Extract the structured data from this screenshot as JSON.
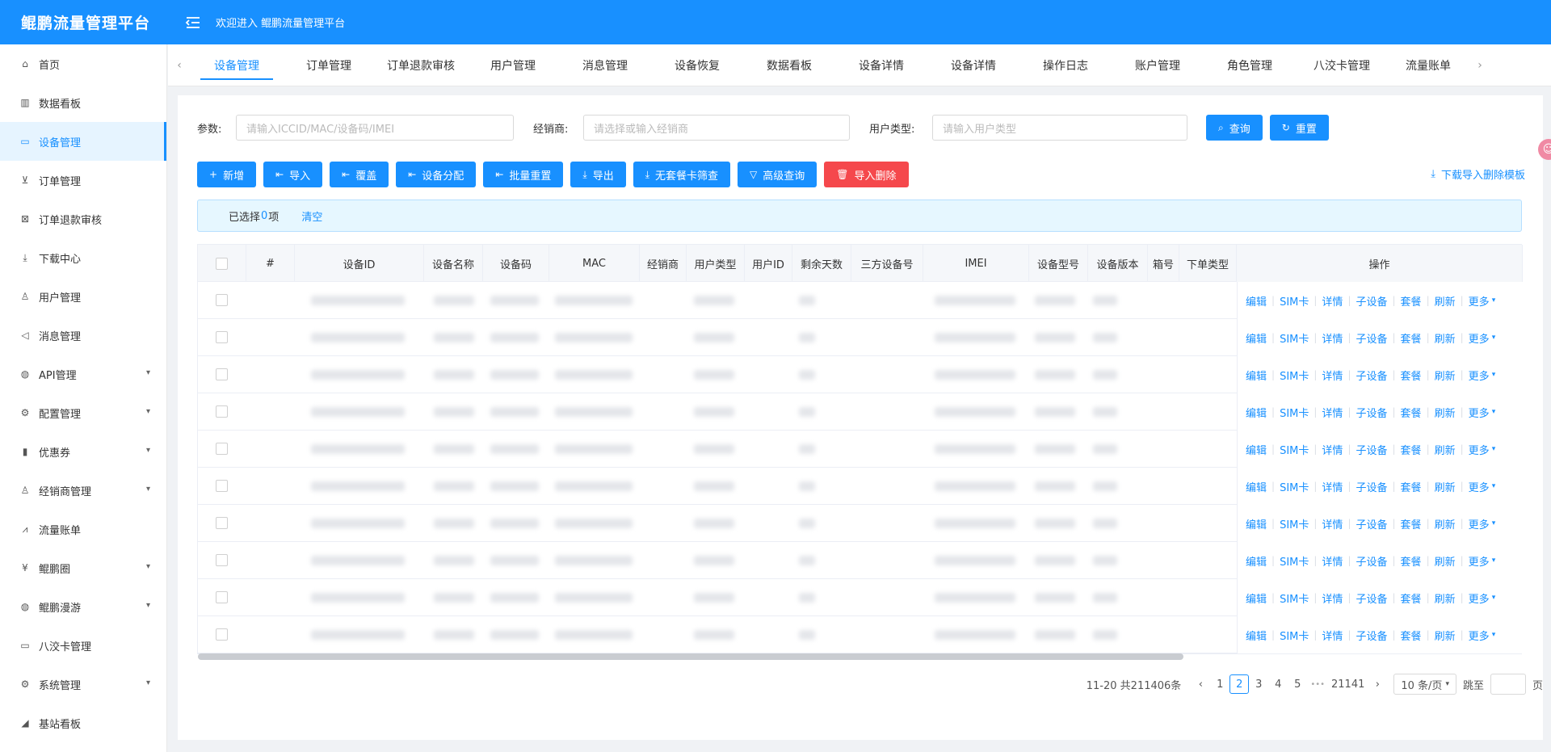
{
  "app": {
    "title": "鲲鹏流量管理平台",
    "welcome": "欢迎进入 鲲鹏流量管理平台"
  },
  "sidebar": {
    "items": [
      {
        "label": "首页",
        "icon": "home-icon"
      },
      {
        "label": "数据看板",
        "icon": "bar-chart-icon"
      },
      {
        "label": "设备管理",
        "icon": "device-icon"
      },
      {
        "label": "订单管理",
        "icon": "cart-icon"
      },
      {
        "label": "订单退款审核",
        "icon": "refund-icon"
      },
      {
        "label": "下载中心",
        "icon": "download-icon"
      },
      {
        "label": "用户管理",
        "icon": "user-icon"
      },
      {
        "label": "消息管理",
        "icon": "speaker-icon"
      },
      {
        "label": "API管理",
        "icon": "globe-icon"
      },
      {
        "label": "配置管理",
        "icon": "gear-icon"
      },
      {
        "label": "优惠券",
        "icon": "barcode-icon"
      },
      {
        "label": "经销商管理",
        "icon": "user-icon"
      },
      {
        "label": "流量账单",
        "icon": "line-chart-icon"
      },
      {
        "label": "鲲鹏圈",
        "icon": "yen-icon"
      },
      {
        "label": "鲲鹏漫游",
        "icon": "globe-icon"
      },
      {
        "label": "八洨卡管理",
        "icon": "monitor-icon"
      },
      {
        "label": "系统管理",
        "icon": "gear-icon"
      },
      {
        "label": "基站看板",
        "icon": "area-chart-icon"
      }
    ]
  },
  "tabs": [
    "设备管理",
    "订单管理",
    "订单退款审核",
    "用户管理",
    "消息管理",
    "设备恢复",
    "数据看板",
    "设备详情",
    "设备详情",
    "操作日志",
    "账户管理",
    "角色管理",
    "八洨卡管理",
    "流量账单"
  ],
  "search": {
    "param_label": "参数:",
    "param_placeholder": "请输入ICCID/MAC/设备码/IMEI",
    "dealer_label": "经销商:",
    "dealer_placeholder": "请选择或输入经销商",
    "usertype_label": "用户类型:",
    "usertype_placeholder": "请输入用户类型",
    "query": "查询",
    "reset": "重置"
  },
  "actions": {
    "add": "新增",
    "import": "导入",
    "cover": "覆盖",
    "assign": "设备分配",
    "batch_reset": "批量重置",
    "export": "导出",
    "no_plan": "无套餐卡筛查",
    "advanced": "高级查询",
    "import_delete": "导入删除",
    "download_template": "下载导入删除模板"
  },
  "selection": {
    "prefix": "已选择",
    "count": "0",
    "suffix": "项",
    "clear": "清空"
  },
  "table": {
    "columns": [
      "#",
      "设备ID",
      "设备名称",
      "设备码",
      "MAC",
      "经销商",
      "用户类型",
      "用户ID",
      "剩余天数",
      "三方设备号",
      "IMEI",
      "设备型号",
      "设备版本",
      "箱号",
      "下单类型",
      "操作"
    ],
    "row_actions": [
      "编辑",
      "SIM卡",
      "详情",
      "子设备",
      "套餐",
      "刷新",
      "更多"
    ],
    "row_count": 10
  },
  "pagination": {
    "summary": "11-20 共211406条",
    "pages": [
      "1",
      "2",
      "3",
      "4",
      "5"
    ],
    "current": "2",
    "ellipsis": "•••",
    "last": "21141",
    "page_size": "10 条/页",
    "jump_label": "跳至",
    "page_unit": "页"
  }
}
